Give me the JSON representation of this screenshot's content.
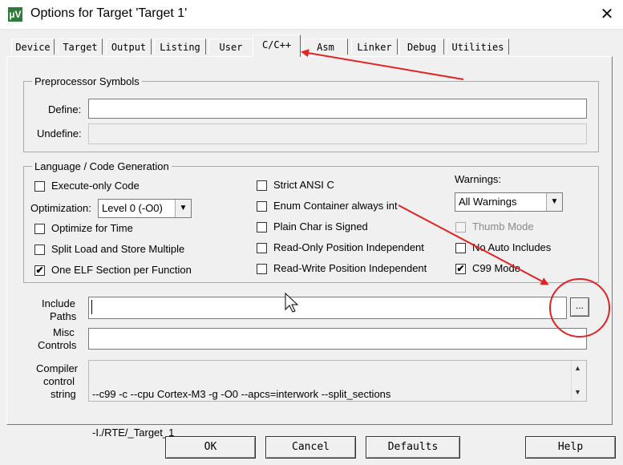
{
  "window": {
    "title": "Options for Target 'Target 1'",
    "app_icon": "µV"
  },
  "tabs": [
    "Device",
    "Target",
    "Output",
    "Listing",
    "User",
    "C/C++",
    "Asm",
    "Linker",
    "Debug",
    "Utilities"
  ],
  "preprocessor": {
    "group_label": "Preprocessor Symbols",
    "define_label": "Define:",
    "define_value": "",
    "undefine_label": "Undefine:",
    "undefine_value": ""
  },
  "codegen": {
    "group_label": "Language / Code Generation",
    "execute_only": {
      "label": "Execute-only Code",
      "checked": false
    },
    "optimization_label": "Optimization:",
    "optimization_value": "Level 0 (-O0)",
    "optimize_time": {
      "label": "Optimize for Time",
      "checked": false
    },
    "split_load": {
      "label": "Split Load and Store Multiple",
      "checked": false
    },
    "one_elf": {
      "label": "One ELF Section per Function",
      "checked": true
    },
    "strict_ansi": {
      "label": "Strict ANSI C",
      "checked": false
    },
    "enum_container": {
      "label": "Enum Container always int",
      "checked": false
    },
    "plain_char": {
      "label": "Plain Char is Signed",
      "checked": false
    },
    "ropi": {
      "label": "Read-Only Position Independent",
      "checked": false
    },
    "rwpi": {
      "label": "Read-Write Position Independent",
      "checked": false
    },
    "warnings_label": "Warnings:",
    "warnings_value": "All Warnings",
    "thumb_mode": {
      "label": "Thumb Mode",
      "checked": false
    },
    "no_auto_includes": {
      "label": "No Auto Includes",
      "checked": false
    },
    "c99_mode": {
      "label": "C99 Mode",
      "checked": true
    }
  },
  "include": {
    "label_line1": "Include",
    "label_line2": "Paths",
    "value": "",
    "browse_label": "..."
  },
  "misc": {
    "label_line1": "Misc",
    "label_line2": "Controls",
    "value": ""
  },
  "compiler": {
    "label_line1": "Compiler",
    "label_line2": "control",
    "label_line3": "string",
    "line1": "--c99 -c --cpu Cortex-M3 -g -O0 --apcs=interwork --split_sections",
    "line2": "-I./RTE/_Target_1"
  },
  "buttons": {
    "ok": "OK",
    "cancel": "Cancel",
    "defaults": "Defaults",
    "help": "Help"
  },
  "colors": {
    "annotation": "#e32222",
    "check": "✔"
  }
}
